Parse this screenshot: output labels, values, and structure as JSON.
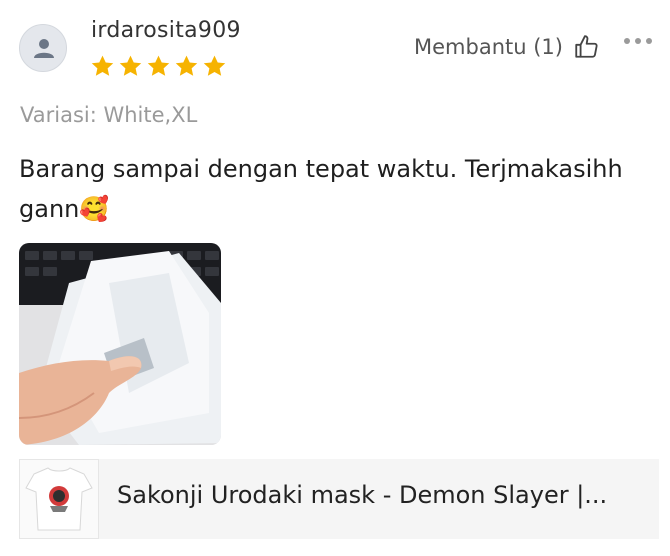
{
  "review": {
    "username": "irdarosita909",
    "rating": 5,
    "rating_max": 5,
    "helpful_label": "Membantu (1)",
    "variation": "Variasi: White,XL",
    "comment": "Barang sampai dengan tepat waktu. Terjmakasihh gann🥰"
  },
  "product": {
    "title": "Sakonji Urodaki mask - Demon Slayer |..."
  },
  "colors": {
    "star": "#f6b301",
    "text_muted": "#9a9a9a",
    "product_bg": "#f5f5f5"
  },
  "icons": {
    "avatar": "user-icon",
    "helpful": "thumbs-up-icon",
    "more": "more-horizontal-icon",
    "star": "star-icon"
  }
}
